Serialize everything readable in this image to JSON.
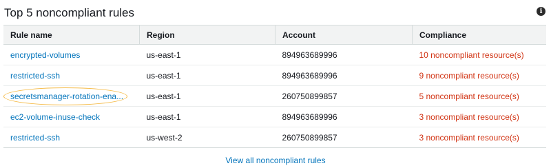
{
  "panel": {
    "title": "Top 5 noncompliant rules",
    "info_icon": "info-icon"
  },
  "table": {
    "columns": [
      "Rule name",
      "Region",
      "Account",
      "Compliance"
    ],
    "rows": [
      {
        "rule": "encrypted-volumes",
        "region": "us-east-1",
        "account": "894963689996",
        "compliance": "10 noncompliant resource(s)"
      },
      {
        "rule": "restricted-ssh",
        "region": "us-east-1",
        "account": "894963689996",
        "compliance": "9 noncompliant resource(s)"
      },
      {
        "rule": "secretsmanager-rotation-ena...",
        "region": "us-east-1",
        "account": "260750899857",
        "compliance": "5 noncompliant resource(s)"
      },
      {
        "rule": "ec2-volume-inuse-check",
        "region": "us-east-1",
        "account": "894963689996",
        "compliance": "3 noncompliant resource(s)"
      },
      {
        "rule": "restricted-ssh",
        "region": "us-west-2",
        "account": "260750899857",
        "compliance": "3 noncompliant resource(s)"
      }
    ]
  },
  "footer": {
    "view_all_label": "View all noncompliant rules"
  },
  "colors": {
    "link": "#0073bb",
    "noncompliant": "#d13212",
    "highlight": "#f5b942"
  }
}
